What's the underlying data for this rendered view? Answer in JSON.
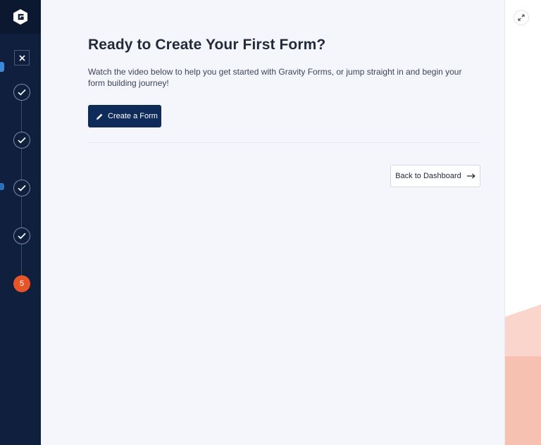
{
  "sidebar": {
    "logo_icon": "gravity-forms-logo-icon",
    "close_icon": "close-icon",
    "steps": [
      {
        "state": "complete",
        "icon": "check-icon"
      },
      {
        "state": "complete",
        "icon": "check-icon"
      },
      {
        "state": "complete",
        "icon": "check-icon"
      },
      {
        "state": "complete",
        "icon": "check-icon"
      },
      {
        "state": "current",
        "label": "5"
      }
    ],
    "colors": {
      "background": "#0f1f3d",
      "active_step": "#e65527"
    }
  },
  "main": {
    "title": "Ready to Create Your First Form?",
    "description": "Watch the video below to help you get started with Gravity Forms, or jump straight in and begin your form building journey!",
    "create_button": {
      "label": "Create a Form",
      "icon": "pencil-icon"
    },
    "back_button": {
      "label": "Back to Dashboard",
      "icon": "arrow-right-icon"
    },
    "colors": {
      "primary_button": "#0f2b59"
    }
  },
  "right_panel": {
    "expand_icon": "expand-icon",
    "colors": {
      "decor_light": "#f9d5cb",
      "decor_strong": "#f7c1b1"
    }
  }
}
